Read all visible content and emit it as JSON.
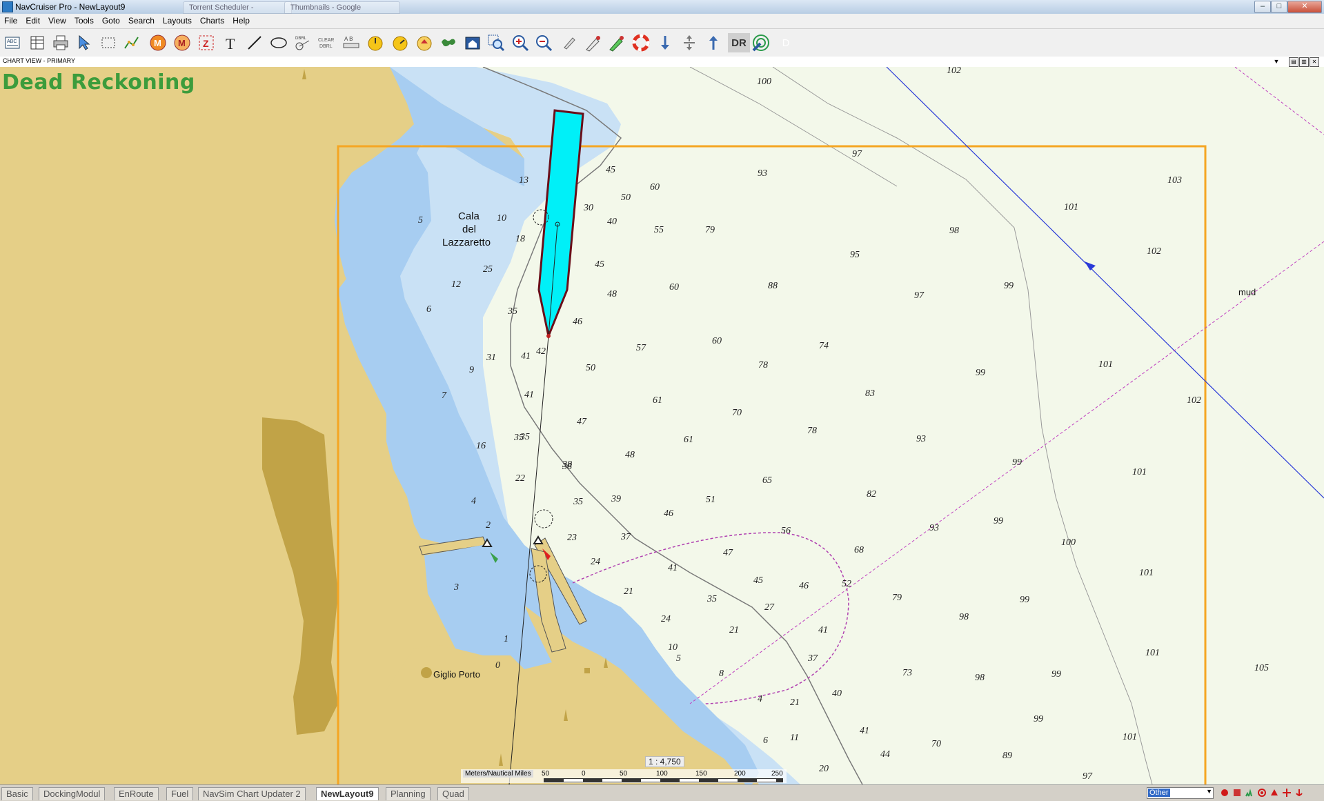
{
  "window": {
    "title": "NavCruiser Pro - NewLayout9",
    "ghost_tabs": [
      "Torrent Scheduler - Windows",
      "Thumbnails - Google"
    ],
    "buttons": {
      "minimize": "–",
      "maximize": "□",
      "close": "✕"
    }
  },
  "menu": [
    "File",
    "Edit",
    "View",
    "Tools",
    "Goto",
    "Search",
    "Layouts",
    "Charts",
    "Help"
  ],
  "toolbar": {
    "tools": [
      "abc-route",
      "table",
      "print",
      "select-arrow",
      "select-rectangle",
      "route-tool",
      "man-overboard-m",
      "waypoint-m",
      "zone-z",
      "text-T",
      "line",
      "ellipse",
      "dbrl",
      "clear-dbrl",
      "ab-ruler",
      "compass-1",
      "compass-2",
      "compass-3",
      "world-map",
      "home",
      "zoom-window",
      "zoom-in",
      "zoom-out",
      "pencil",
      "draw-pen",
      "green-pen",
      "lifebuoy",
      "arrow-down",
      "split-arrows",
      "arrow-up",
      "dr",
      "radar",
      "d"
    ],
    "dr_label": "DR",
    "d_label": "D"
  },
  "chart_view": {
    "label": "CHART VIEW - PRIMARY"
  },
  "map": {
    "mode_title": "Dead Reckoning",
    "place_names": {
      "cala": "Cala",
      "del": "del",
      "lazzaretto": "Lazzaretto",
      "giglio_porto": "Giglio Porto",
      "mud": "mud"
    },
    "scale_ratio": "1 : 4,750",
    "scale_bar": {
      "units_label": "Meters/Nautical Miles",
      "ticks": [
        "50",
        "0",
        "50",
        "100",
        "150",
        "200",
        "250"
      ]
    },
    "depth_soundings": [
      "100",
      "102",
      "97",
      "93",
      "103",
      "101",
      "45",
      "60",
      "50",
      "40",
      "55",
      "79",
      "98",
      "95",
      "102",
      "45",
      "48",
      "60",
      "88",
      "97",
      "99",
      "46",
      "57",
      "60",
      "74",
      "42",
      "50",
      "78",
      "101",
      "83",
      "99",
      "102",
      "41",
      "61",
      "70",
      "47",
      "61",
      "78",
      "93",
      "35",
      "38",
      "48",
      "65",
      "99",
      "101",
      "35",
      "39",
      "46",
      "51",
      "82",
      "93",
      "99",
      "37",
      "23",
      "56",
      "68",
      "100",
      "47",
      "24",
      "45",
      "46",
      "52",
      "21",
      "41",
      "35",
      "79",
      "99",
      "101",
      "27",
      "24",
      "21",
      "41",
      "98",
      "5",
      "37",
      "10",
      "8",
      "73",
      "98",
      "99",
      "101",
      "105",
      "40",
      "21",
      "4",
      "99",
      "41",
      "44",
      "70",
      "89",
      "101",
      "11",
      "6",
      "97",
      "20",
      "30",
      "25",
      "35",
      "31",
      "41",
      "35",
      "38",
      "22",
      "13",
      "10",
      "18",
      "16",
      "12",
      "9",
      "7",
      "6",
      "5",
      "4",
      "3",
      "2",
      "1",
      "0"
    ]
  },
  "tabs": [
    "Basic",
    "DockingModul",
    "EnRoute",
    "Fuel",
    "NavSim Chart Updater 2",
    "NewLayout9",
    "Planning",
    "Quad"
  ],
  "active_tab": "NewLayout9",
  "status": {
    "select_value": "Other"
  },
  "colors": {
    "land": "#e5cf87",
    "land_dark": "#c1a347",
    "shallow_water": "#a7cdf1",
    "mid_water": "#c9e1f5",
    "deep_water": "#f3f8ea",
    "chart_border": "#f5a623",
    "vessel": "#00f0f8",
    "dr_title": "#3c9c3c"
  }
}
